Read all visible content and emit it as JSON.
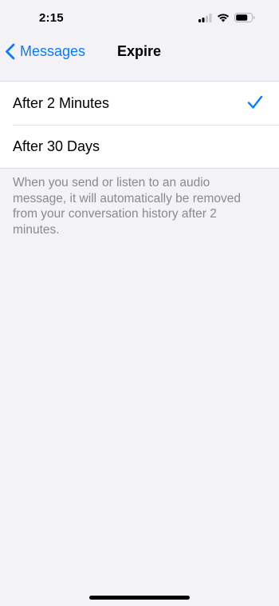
{
  "status_bar": {
    "time": "2:15",
    "signal_icon": "signal-icon",
    "wifi_icon": "wifi-icon",
    "battery_icon": "battery-icon"
  },
  "nav": {
    "back_label": "Messages",
    "back_icon": "chevron-left-icon",
    "title": "Expire"
  },
  "options": [
    {
      "label": "After 2 Minutes",
      "selected": true
    },
    {
      "label": "After 30 Days",
      "selected": false
    }
  ],
  "footer": {
    "text": "When you send or listen to an audio message, it will automatically be removed from your conversation history after 2 minutes."
  },
  "colors": {
    "accent": "#0a7aff",
    "background": "#f2f2f7",
    "secondary_text": "#8a8a8e"
  }
}
